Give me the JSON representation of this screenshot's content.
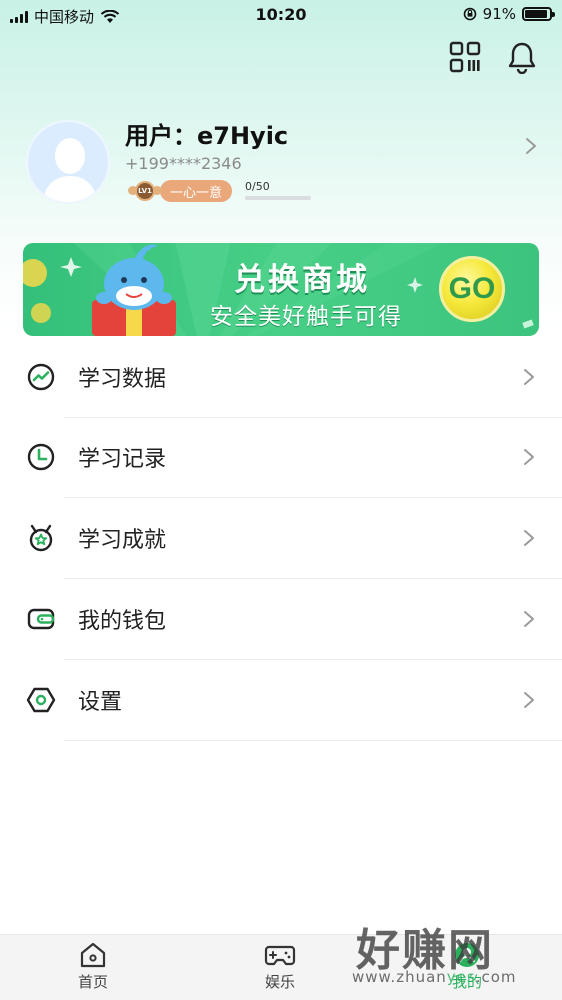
{
  "status_bar": {
    "carrier": "中国移动",
    "time": "10:20",
    "battery_percent": "91%",
    "battery_level": 0.91
  },
  "header": {
    "icons": [
      "qr-code-icon",
      "bell-icon"
    ]
  },
  "profile": {
    "username": "用户：e7Hyic",
    "phone": "+199****2346",
    "level_badge": "LV1",
    "level_title": "一心一意",
    "progress_text": "0/50",
    "progress_value": 0
  },
  "banner": {
    "title": "兑换商城",
    "subtitle": "安全美好触手可得",
    "go_label": "GO"
  },
  "menu": [
    {
      "label": "学习数据",
      "icon": "trend-chart-icon"
    },
    {
      "label": "学习记录",
      "icon": "clock-icon"
    },
    {
      "label": "学习成就",
      "icon": "medal-icon"
    },
    {
      "label": "我的钱包",
      "icon": "wallet-icon"
    },
    {
      "label": "设置",
      "icon": "hexagon-settings-icon"
    }
  ],
  "tab_bar": {
    "tabs": [
      {
        "label": "首页",
        "icon": "home-icon"
      },
      {
        "label": "娱乐",
        "icon": "gamepad-icon"
      },
      {
        "label": "我的",
        "icon": "profile-icon",
        "active": true
      }
    ]
  },
  "watermark": {
    "text": "好赚网",
    "url_prefix": "www.zhuan",
    "url_accent": "yes",
    "url_suffix": ".com"
  },
  "colors": {
    "accent_green": "#2bb15e",
    "level_orange": "#e9a77a",
    "banner_green": "#48cf86",
    "go_yellow": "#f6e93c"
  }
}
